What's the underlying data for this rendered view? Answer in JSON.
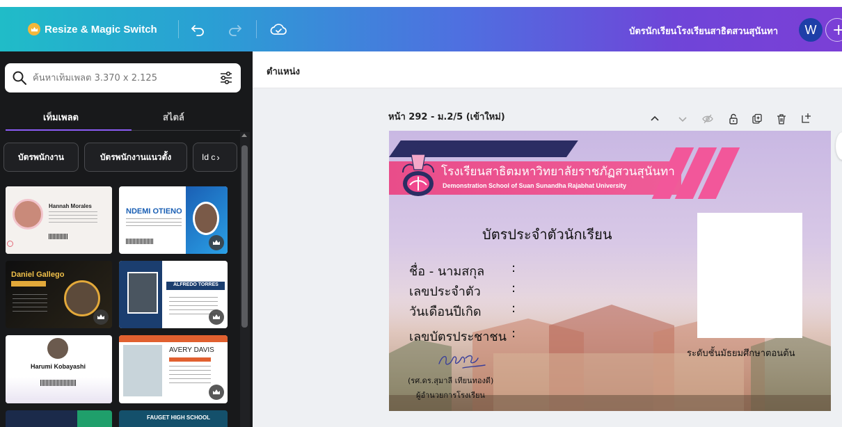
{
  "topbar": {
    "resize_label": "Resize & Magic Switch",
    "doc_title": "บัตรนักเรียนโรงเรียนสาธิตสวนสุนันทา",
    "avatar_letter": "W",
    "plus": "+"
  },
  "search": {
    "placeholder": "ค้นหาเท็มเพลต 3.370 x 2.125"
  },
  "panel_tabs": {
    "templates": "เท็มเพลต",
    "styles": "สไตล์"
  },
  "chips": [
    {
      "label": "บัตรพนักงาน"
    },
    {
      "label": "บัตรพนักงานแนวตั้ง"
    },
    {
      "label": "Id c"
    }
  ],
  "templates": [
    {
      "name": "Hannah Morales"
    },
    {
      "name": "NDEMI OTIENO"
    },
    {
      "name": "Daniel Gallego"
    },
    {
      "name": "ALFREDO TORRES"
    },
    {
      "name": "Harumi Kobayashi"
    },
    {
      "name": "AVERY DAVIS"
    },
    {
      "name": ""
    },
    {
      "name": "FAUGET HIGH SCHOOL"
    }
  ],
  "editor": {
    "position_label": "ตำแหน่ง",
    "page_header": "หน้า 292 - ม.2/5 (เข้าใหม่)"
  },
  "card": {
    "school_th": "โรงเรียนสาธิตมหาวิทยาลัยราชภัฏสวนสุนันทา",
    "school_en": "Demonstration School of Suan Sunandha Rajabhat University",
    "title": "บัตรประจำตัวนักเรียน",
    "fields": [
      {
        "label": "ชื่อ - นามสกุล",
        "colon": ":"
      },
      {
        "label": "เลขประจำตัว",
        "colon": ":"
      },
      {
        "label": "วันเดือนปีเกิด",
        "colon": ":"
      },
      {
        "label": "เลขบัตรประชาชน",
        "colon": ":"
      }
    ],
    "level": "ระดับชั้นมัธยมศึกษาตอนต้น",
    "signer_name": "(รศ.ดร.สุมาลี เทียนทองดี)",
    "signer_role": "ผู้อำนวยการโรงเรียน"
  },
  "colors": {
    "panel_bg": "#18191b",
    "accent_purple": "#8b5cf6",
    "band_pink": "#f0488e",
    "stripe_navy": "#2b2d63"
  }
}
